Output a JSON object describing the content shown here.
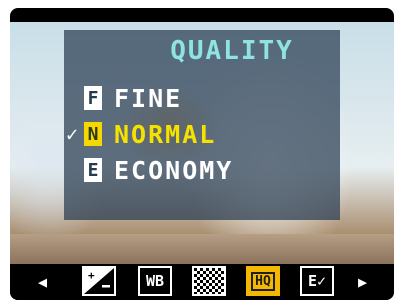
{
  "menu": {
    "title": "QUALITY",
    "selected_mark": "✓",
    "options": [
      {
        "key": "F",
        "label": "FINE",
        "selected": false
      },
      {
        "key": "N",
        "label": "NORMAL",
        "selected": true
      },
      {
        "key": "E",
        "label": "ECONOMY",
        "selected": false
      }
    ]
  },
  "toolbar": {
    "left_arrow": "◀",
    "right_arrow": "▶",
    "icons": [
      {
        "name": "exposure-compensation-icon",
        "label": ""
      },
      {
        "name": "white-balance-icon",
        "label": "WB"
      },
      {
        "name": "checker-icon",
        "label": ""
      },
      {
        "name": "image-quality-icon",
        "label": "HQ",
        "active": true
      },
      {
        "name": "list-check-icon",
        "label": "E✓"
      }
    ]
  },
  "colors": {
    "title": "#8fe3e3",
    "selected_text": "#f5e200",
    "active_icon": "#f5b800",
    "panel": "#28405a"
  }
}
